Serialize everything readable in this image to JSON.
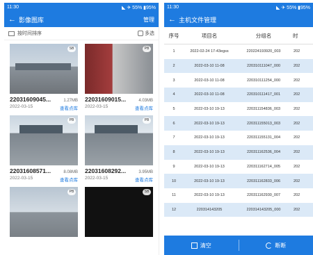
{
  "left": {
    "status": {
      "time": "11:30",
      "right": "◣ ✈ 55% ▮95%"
    },
    "title": "影像图库",
    "manage": "管理",
    "sort_label": "按时间排序",
    "multi_label": "多选",
    "items": [
      {
        "name": "22031609045...",
        "size": "1.27MB",
        "date": "2022-03-15",
        "link": "查看点库",
        "badge": "SB",
        "style": "sky"
      },
      {
        "name": "22031609015...",
        "size": "4.03MB",
        "date": "2022-03-15",
        "link": "查看点库",
        "badge": "PB",
        "style": "red"
      },
      {
        "name": "22031608571...",
        "size": "8.08MB",
        "date": "2022-03-15",
        "link": "查看点库",
        "badge": "PB",
        "style": "building"
      },
      {
        "name": "22031608292...",
        "size": "3.95MB",
        "date": "2022-03-15",
        "link": "查看点库",
        "badge": "PB",
        "style": "building"
      },
      {
        "name": "",
        "size": "",
        "date": "",
        "link": "",
        "badge": "PB",
        "style": "city"
      },
      {
        "name": "",
        "size": "",
        "date": "",
        "link": "",
        "badge": "SB",
        "style": "dark"
      }
    ]
  },
  "right": {
    "status": {
      "time": "11:30",
      "right": "◣ ✈ 55% ▮95%"
    },
    "title": "主机文件管理",
    "headers": [
      "序号",
      "项目名",
      "分组名",
      "时"
    ],
    "rows": [
      {
        "idx": "1",
        "name": "2022-02-24 17-43egss",
        "group": "220224193920_003",
        "extra": "202"
      },
      {
        "idx": "2",
        "name": "2022-03-10 11-08",
        "group": "220310111047_000",
        "extra": "202"
      },
      {
        "idx": "3",
        "name": "2022-03-10 11-08",
        "group": "220310111254_000",
        "extra": "202"
      },
      {
        "idx": "4",
        "name": "2022-03-10 11-08",
        "group": "220310111417_001",
        "extra": "202"
      },
      {
        "idx": "5",
        "name": "2022-03-10 19-13",
        "group": "220311154836_003",
        "extra": "202"
      },
      {
        "idx": "6",
        "name": "2022-03-10 19-13",
        "group": "220311155013_003",
        "extra": "202"
      },
      {
        "idx": "7",
        "name": "2022-03-10 19-13",
        "group": "220311155131_004",
        "extra": "202"
      },
      {
        "idx": "8",
        "name": "2022-03-10 19-13",
        "group": "220311162536_004",
        "extra": "202"
      },
      {
        "idx": "9",
        "name": "2022-03-10 19-13",
        "group": "220311162714_005",
        "extra": "202"
      },
      {
        "idx": "10",
        "name": "2022-03-10 19-13",
        "group": "220311162833_006",
        "extra": "202"
      },
      {
        "idx": "11",
        "name": "2022-03-10 19-13",
        "group": "220311162930_007",
        "extra": "202"
      },
      {
        "idx": "12",
        "name": "220314143205",
        "group": "220314143205_000",
        "extra": "202"
      }
    ],
    "clear_label": "清空",
    "disconnect_label": "断断"
  }
}
